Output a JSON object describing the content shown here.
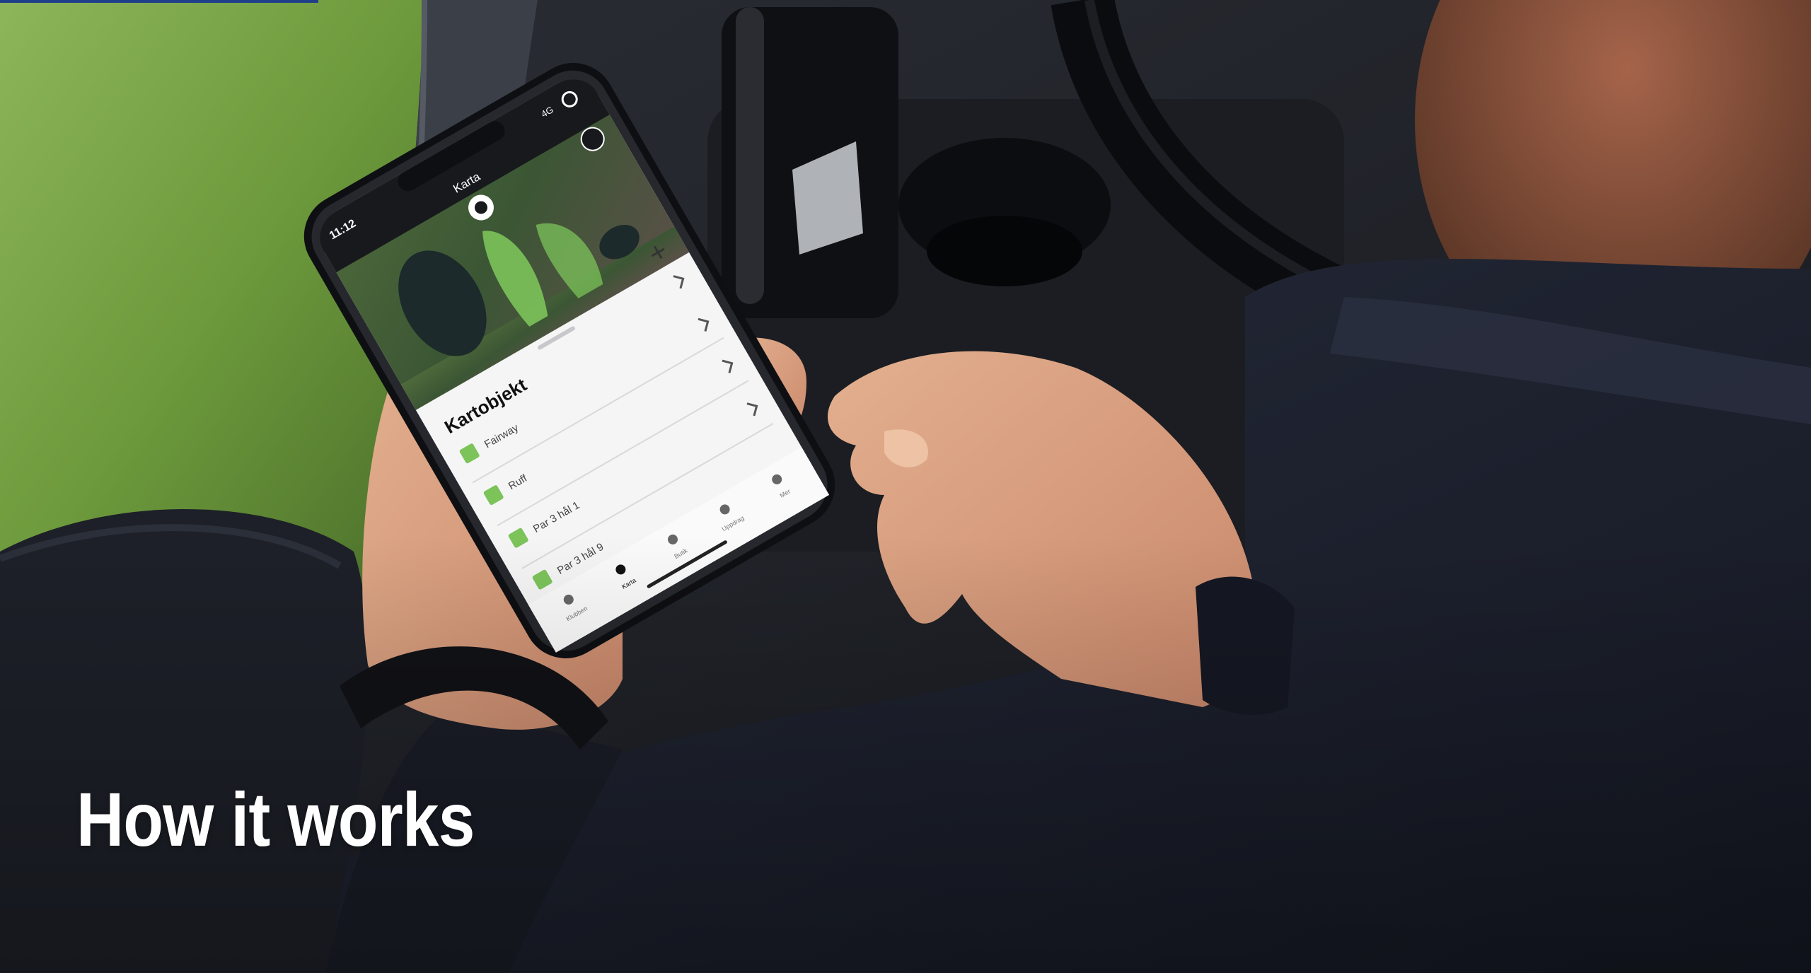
{
  "hero": {
    "title": "How it works"
  },
  "phone": {
    "status_time": "11:12",
    "status_network": "4G",
    "header_title": "Karta",
    "panel_title": "Kartobjekt",
    "items": [
      {
        "label": "Fairway"
      },
      {
        "label": "Ruff"
      },
      {
        "label": "Par 3 hål 1"
      },
      {
        "label": "Par 3 hål 9"
      }
    ],
    "tabs": [
      {
        "label": "Klubben"
      },
      {
        "label": "Karta"
      },
      {
        "label": "Butik"
      },
      {
        "label": "Uppdrag"
      },
      {
        "label": "Mer"
      }
    ]
  },
  "colors": {
    "accent": "#1f3f8a",
    "title_text": "#ffffff",
    "grass": "#5f8a32",
    "sweater": "#1e2230",
    "item_square": "#7cc35a"
  }
}
